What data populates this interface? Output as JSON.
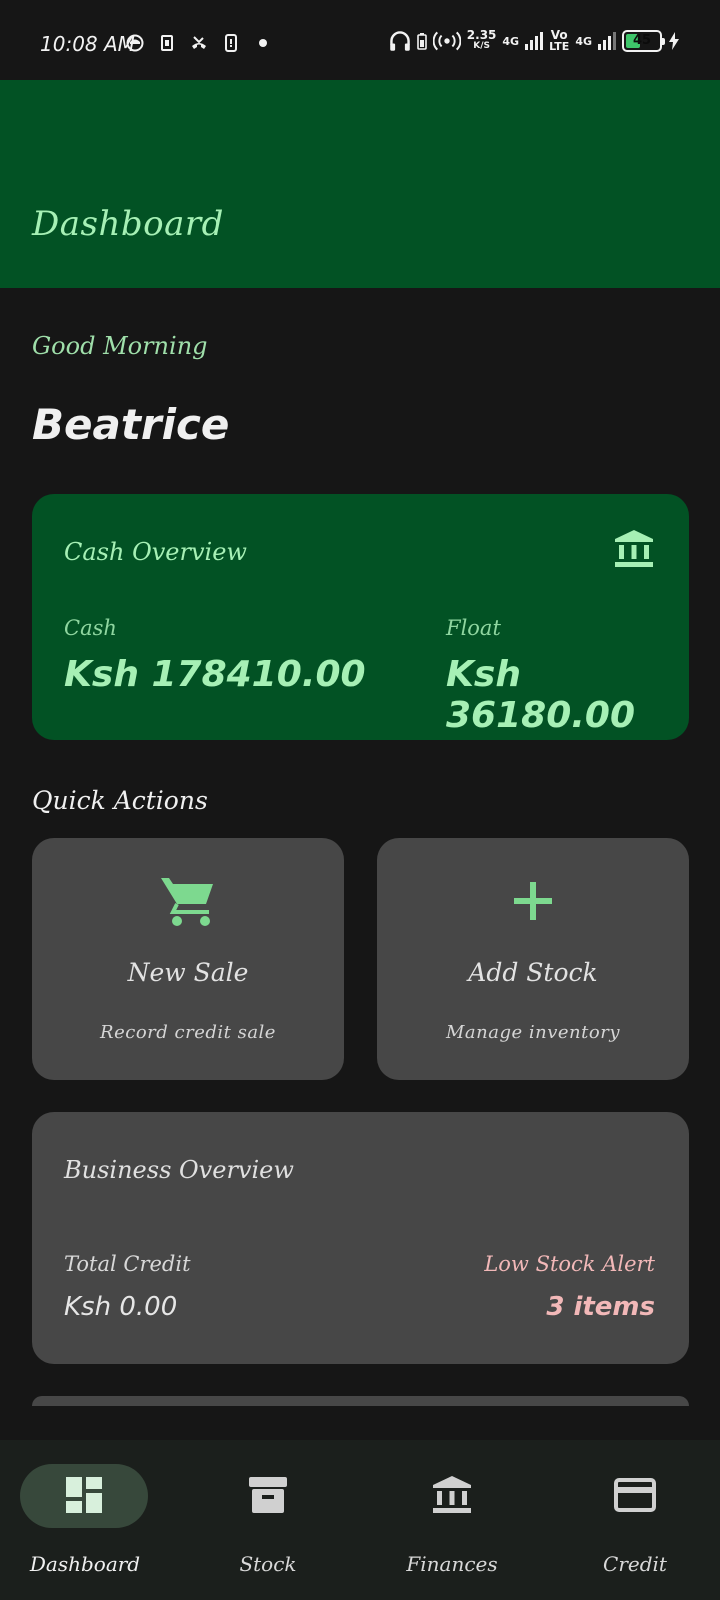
{
  "status_bar": {
    "time": "10:08 AM",
    "speed_value": "2.35",
    "speed_unit": "K/S",
    "net_1": "4G",
    "volte_top": "Vo",
    "volte_bottom": "LTE",
    "net_2": "4G",
    "battery": "45"
  },
  "header": {
    "title": "Dashboard"
  },
  "greeting": {
    "text": "Good Morning",
    "name": "Beatrice"
  },
  "cash_overview": {
    "title": "Cash Overview",
    "icon": "bank-icon",
    "cash_label": "Cash",
    "cash_value": "Ksh 178410.00",
    "float_label": "Float",
    "float_value": "Ksh 36180.00"
  },
  "quick_actions": {
    "title": "Quick Actions",
    "items": [
      {
        "label": "New Sale",
        "subtitle": "Record credit sale",
        "icon": "cart-icon"
      },
      {
        "label": "Add Stock",
        "subtitle": "Manage inventory",
        "icon": "plus-icon"
      }
    ]
  },
  "business_overview": {
    "title": "Business Overview",
    "total_credit_label": "Total Credit",
    "total_credit_value": "Ksh 0.00",
    "low_stock_label": "Low Stock Alert",
    "low_stock_value": "3 items"
  },
  "bottom_nav": {
    "items": [
      {
        "label": "Dashboard",
        "icon": "dashboard-icon",
        "active": true
      },
      {
        "label": "Stock",
        "icon": "archive-icon",
        "active": false
      },
      {
        "label": "Finances",
        "icon": "bank-icon",
        "active": false
      },
      {
        "label": "Credit",
        "icon": "credit-card-icon",
        "active": false
      }
    ]
  },
  "colors": {
    "primary_dark": "#025224",
    "accent": "#a6f0b5",
    "card": "#474747",
    "background": "#161616",
    "alert": "#f2b8b8"
  }
}
